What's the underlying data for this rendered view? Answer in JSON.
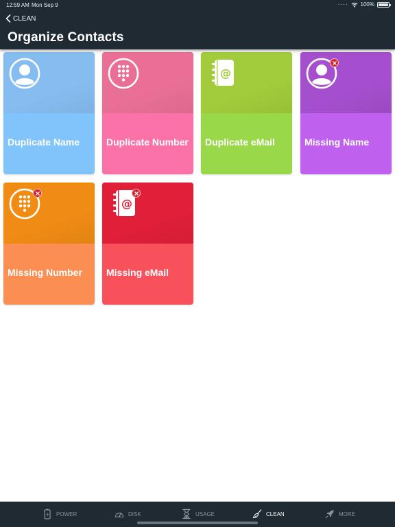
{
  "status_bar": {
    "time": "12:59 AM",
    "date": "Mon Sep 9",
    "battery": "100%"
  },
  "header": {
    "back_label": "CLEAN",
    "title": "Organize Contacts"
  },
  "tiles": [
    {
      "label": "Duplicate Name",
      "icon": "person-icon",
      "missing": false,
      "top_color": "#86bdf1",
      "bottom_color": "#80c4fb"
    },
    {
      "label": "Duplicate Number",
      "icon": "dialpad-icon",
      "missing": false,
      "top_color": "#ea6f97",
      "bottom_color": "#fb72a9"
    },
    {
      "label": "Duplicate eMail",
      "icon": "address-book-icon",
      "missing": false,
      "top_color": "#a2cc3b",
      "bottom_color": "#99d848"
    },
    {
      "label": "Missing Name",
      "icon": "person-icon",
      "missing": true,
      "top_color": "#a54fcf",
      "bottom_color": "#c060ef"
    },
    {
      "label": "Missing Number",
      "icon": "dialpad-icon",
      "missing": true,
      "top_color": "#f08c14",
      "bottom_color": "#fb8f53"
    },
    {
      "label": "Missing eMail",
      "icon": "address-book-icon",
      "missing": true,
      "top_color": "#e11f39",
      "bottom_color": "#f9515c"
    }
  ],
  "tabbar": {
    "tabs": [
      {
        "label": "POWER",
        "icon": "battery-icon",
        "active": false
      },
      {
        "label": "DISK",
        "icon": "gauge-icon",
        "active": false
      },
      {
        "label": "USAGE",
        "icon": "hourglass-icon",
        "active": false
      },
      {
        "label": "CLEAN",
        "icon": "broom-icon",
        "active": true
      },
      {
        "label": "MORE",
        "icon": "rocket-icon",
        "active": false
      }
    ]
  }
}
